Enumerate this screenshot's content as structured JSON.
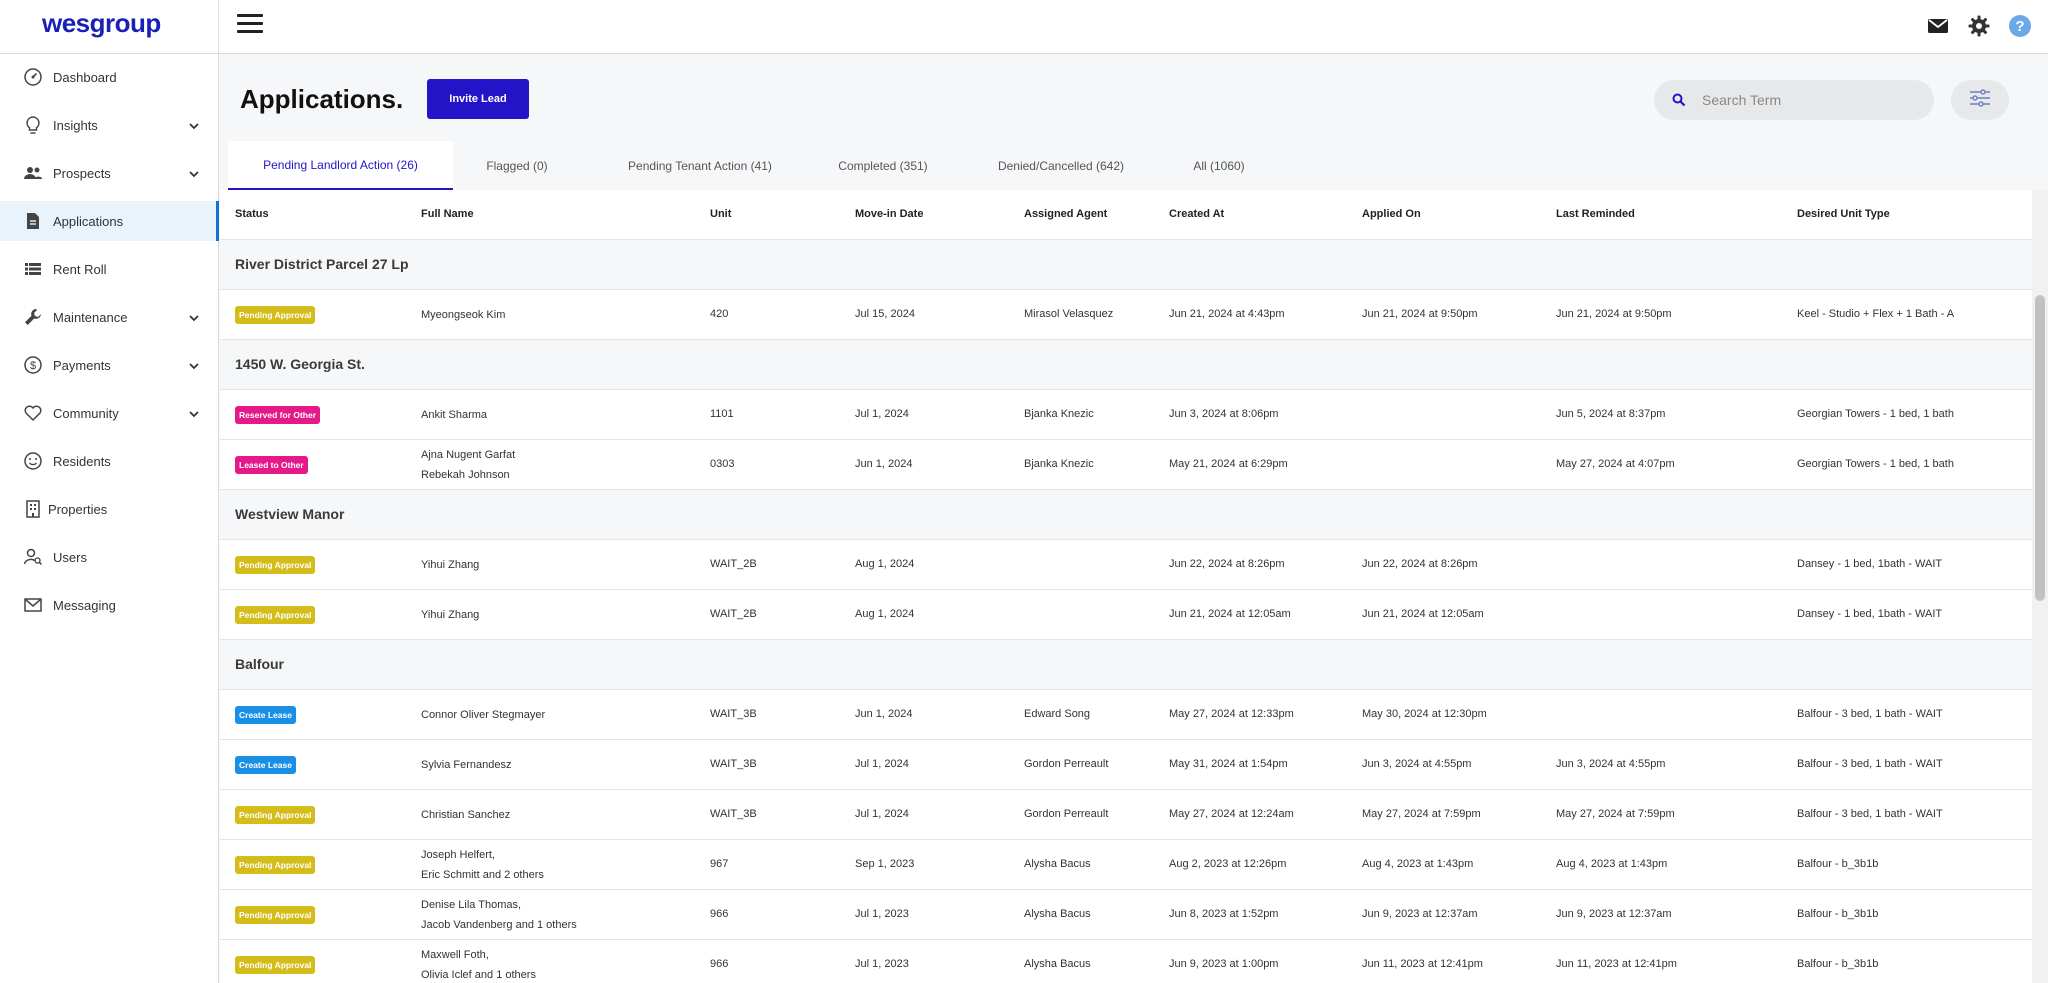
{
  "brand": {
    "logo_text": "wesgroup",
    "accent": "#2314c8"
  },
  "topbar": {
    "icons": [
      "hamburger-menu-icon",
      "mail-icon",
      "settings-gear-icon",
      "help-icon"
    ]
  },
  "sidebar": {
    "items": [
      {
        "label": "Dashboard",
        "icon": "dashboard-gauge-icon",
        "has_chevron": false,
        "active": false
      },
      {
        "label": "Insights",
        "icon": "lightbulb-icon",
        "has_chevron": true,
        "active": false
      },
      {
        "label": "Prospects",
        "icon": "people-icon",
        "has_chevron": true,
        "active": false
      },
      {
        "label": "Applications",
        "icon": "document-icon",
        "has_chevron": false,
        "active": true
      },
      {
        "label": "Rent Roll",
        "icon": "list-icon",
        "has_chevron": false,
        "active": false
      },
      {
        "label": "Maintenance",
        "icon": "wrench-icon",
        "has_chevron": true,
        "active": false
      },
      {
        "label": "Payments",
        "icon": "dollar-icon",
        "has_chevron": true,
        "active": false
      },
      {
        "label": "Community",
        "icon": "heart-icon",
        "has_chevron": true,
        "active": false
      },
      {
        "label": "Residents",
        "icon": "smiley-icon",
        "has_chevron": false,
        "active": false
      },
      {
        "label": "Properties",
        "icon": "building-icon",
        "has_chevron": false,
        "active": false
      },
      {
        "label": "Users",
        "icon": "user-search-icon",
        "has_chevron": false,
        "active": false
      },
      {
        "label": "Messaging",
        "icon": "envelope-icon",
        "has_chevron": false,
        "active": false
      }
    ]
  },
  "header": {
    "title": "Applications.",
    "invite_button": "Invite Lead"
  },
  "search": {
    "placeholder": "Search Term",
    "value": ""
  },
  "tabs": [
    {
      "label": "Pending Landlord Action (26)",
      "active": true
    },
    {
      "label": "Flagged (0)",
      "active": false
    },
    {
      "label": "Pending Tenant Action (41)",
      "active": false
    },
    {
      "label": "Completed (351)",
      "active": false
    },
    {
      "label": "Denied/Cancelled (642)",
      "active": false
    },
    {
      "label": "All (1060)",
      "active": false
    }
  ],
  "table": {
    "columns": [
      "Status",
      "Full Name",
      "Unit",
      "Move-in Date",
      "Assigned Agent",
      "Created At",
      "Applied On",
      "Last Reminded",
      "Desired Unit Type"
    ],
    "status_colors": {
      "Pending Approval": "#d4bd1a",
      "Reserved for Other": "#e6198a",
      "Leased to Other": "#e6198a",
      "Create Lease": "#1a8fe6"
    },
    "groups": [
      {
        "name": "River District Parcel 27 Lp",
        "rows": [
          {
            "status": "Pending Approval",
            "names": [
              "Myeongseok Kim"
            ],
            "unit": "420",
            "move_in": "Jul 15, 2024",
            "agent": "Mirasol Velasquez",
            "created": "Jun 21, 2024 at 4:43pm",
            "applied": "Jun 21, 2024 at 9:50pm",
            "reminded": "Jun 21, 2024 at 9:50pm",
            "unit_type": "Keel - Studio + Flex + 1 Bath - A"
          }
        ]
      },
      {
        "name": "1450 W. Georgia St.",
        "rows": [
          {
            "status": "Reserved for Other",
            "names": [
              "Ankit Sharma"
            ],
            "unit": "1101",
            "move_in": "Jul 1, 2024",
            "agent": "Bjanka Knezic",
            "created": "Jun 3, 2024 at 8:06pm",
            "applied": "",
            "reminded": "Jun 5, 2024 at 8:37pm",
            "unit_type": "Georgian Towers - 1 bed, 1 bath"
          },
          {
            "status": "Leased to Other",
            "names": [
              "Ajna Nugent Garfat",
              "Rebekah Johnson"
            ],
            "unit": "0303",
            "move_in": "Jun 1, 2024",
            "agent": "Bjanka Knezic",
            "created": "May 21, 2024 at 6:29pm",
            "applied": "",
            "reminded": "May 27, 2024 at 4:07pm",
            "unit_type": "Georgian Towers - 1 bed, 1 bath"
          }
        ]
      },
      {
        "name": "Westview Manor",
        "rows": [
          {
            "status": "Pending Approval",
            "names": [
              "Yihui Zhang"
            ],
            "unit": "WAIT_2B",
            "move_in": "Aug 1, 2024",
            "agent": "",
            "created": "Jun 22, 2024 at 8:26pm",
            "applied": "Jun 22, 2024 at 8:26pm",
            "reminded": "",
            "unit_type": "Dansey - 1 bed, 1bath - WAIT"
          },
          {
            "status": "Pending Approval",
            "names": [
              "Yihui Zhang"
            ],
            "unit": "WAIT_2B",
            "move_in": "Aug 1, 2024",
            "agent": "",
            "created": "Jun 21, 2024 at 12:05am",
            "applied": "Jun 21, 2024 at 12:05am",
            "reminded": "",
            "unit_type": "Dansey - 1 bed, 1bath - WAIT"
          }
        ]
      },
      {
        "name": "Balfour",
        "rows": [
          {
            "status": "Create Lease",
            "names": [
              "Connor Oliver Stegmayer"
            ],
            "unit": "WAIT_3B",
            "move_in": "Jun 1, 2024",
            "agent": "Edward Song",
            "created": "May 27, 2024 at 12:33pm",
            "applied": "May 30, 2024 at 12:30pm",
            "reminded": "",
            "unit_type": "Balfour - 3 bed, 1 bath - WAIT"
          },
          {
            "status": "Create Lease",
            "names": [
              "Sylvia Fernandesz"
            ],
            "unit": "WAIT_3B",
            "move_in": "Jul 1, 2024",
            "agent": "Gordon Perreault",
            "created": "May 31, 2024 at 1:54pm",
            "applied": "Jun 3, 2024 at 4:55pm",
            "reminded": "Jun 3, 2024 at 4:55pm",
            "unit_type": "Balfour - 3 bed, 1 bath - WAIT"
          },
          {
            "status": "Pending Approval",
            "names": [
              "Christian Sanchez"
            ],
            "unit": "WAIT_3B",
            "move_in": "Jul 1, 2024",
            "agent": "Gordon Perreault",
            "created": "May 27, 2024 at 12:24am",
            "applied": "May 27, 2024 at 7:59pm",
            "reminded": "May 27, 2024 at 7:59pm",
            "unit_type": "Balfour - 3 bed, 1 bath - WAIT"
          },
          {
            "status": "Pending Approval",
            "names": [
              "Joseph Helfert,",
              "Eric Schmitt and 2 others"
            ],
            "unit": "967",
            "move_in": "Sep 1, 2023",
            "agent": "Alysha Bacus",
            "created": "Aug 2, 2023 at 12:26pm",
            "applied": "Aug 4, 2023 at 1:43pm",
            "reminded": "Aug 4, 2023 at 1:43pm",
            "unit_type": "Balfour - b_3b1b"
          },
          {
            "status": "Pending Approval",
            "names": [
              "Denise Lila Thomas,",
              "Jacob Vandenberg and 1 others"
            ],
            "unit": "966",
            "move_in": "Jul 1, 2023",
            "agent": "Alysha Bacus",
            "created": "Jun 8, 2023 at 1:52pm",
            "applied": "Jun 9, 2023 at 12:37am",
            "reminded": "Jun 9, 2023 at 12:37am",
            "unit_type": "Balfour - b_3b1b"
          },
          {
            "status": "Pending Approval",
            "names": [
              "Maxwell Foth,",
              "Olivia Iclef and 1 others"
            ],
            "unit": "966",
            "move_in": "Jul 1, 2023",
            "agent": "Alysha Bacus",
            "created": "Jun 9, 2023 at 1:00pm",
            "applied": "Jun 11, 2023 at 12:41pm",
            "reminded": "Jun 11, 2023 at 12:41pm",
            "unit_type": "Balfour - b_3b1b"
          }
        ]
      }
    ]
  }
}
